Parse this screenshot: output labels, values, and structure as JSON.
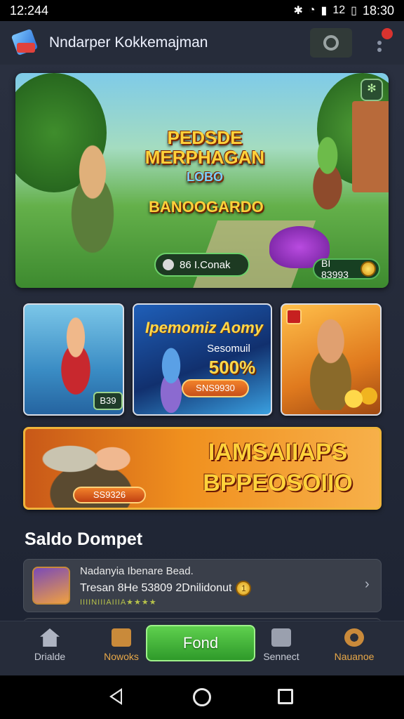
{
  "status_bar": {
    "time": "12:244",
    "clock_right": "18:30",
    "carrier": "12"
  },
  "app_bar": {
    "title": "Nndarper Kokkemajman",
    "notification_count": ""
  },
  "hero": {
    "title_line1": "PEDSDE",
    "title_line2": "MERPHAGAN",
    "logo_text": "LOBO",
    "subtitle": "BANOOGARDO",
    "chip_label": "86 I.Conak",
    "price_label": "BI 83993"
  },
  "cards": [
    {
      "badge": "B39"
    },
    {
      "title": "Ipemomiz Aomy",
      "subtitle": "Sesomuil",
      "percent": "500%",
      "button": "SNS9930"
    },
    {
      "badge": ""
    }
  ],
  "banner": {
    "line1": "IAMSAIIAPS",
    "line2": "BPPEOSOIIO",
    "button": "SS9326"
  },
  "wallet": {
    "section_title": "Saldo Dompet",
    "line1": "Nadanyia Ibenare Bead.",
    "line2": "Tresan 8He 53809 2Dnilidonut",
    "coin": "1",
    "rating": "IIIINIIIAIIIA★★★★"
  },
  "bottom_nav": {
    "items": [
      "Drialde",
      "Nowoks",
      "Fond",
      "Sennect",
      "Nauanoe"
    ]
  },
  "colors": {
    "accent_green": "#3fb53a",
    "accent_orange": "#e8a848",
    "bg": "#1b2130"
  }
}
